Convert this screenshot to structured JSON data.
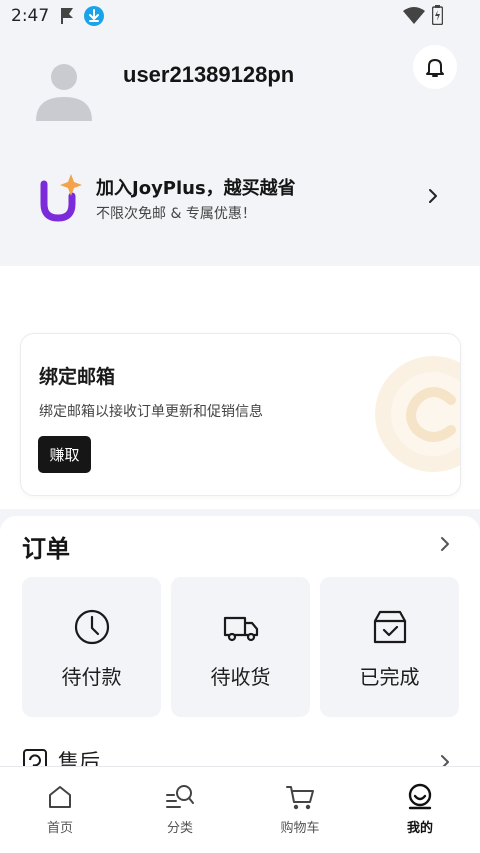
{
  "status_bar": {
    "time": "2:47"
  },
  "profile": {
    "username": "user21389128pn"
  },
  "joyplus": {
    "title": "加入JoyPlus，越买越省",
    "subtitle": "不限次免邮 & 专属优惠！"
  },
  "bind_email": {
    "title": "绑定邮箱",
    "description": "绑定邮箱以接收订单更新和促销信息",
    "button": "赚取"
  },
  "orders": {
    "title": "订单",
    "tiles": [
      {
        "label": "待付款",
        "icon": "clock-icon"
      },
      {
        "label": "待收货",
        "icon": "truck-icon"
      },
      {
        "label": "已完成",
        "icon": "box-check-icon"
      }
    ],
    "aftersale": "售后"
  },
  "nav": [
    {
      "label": "首页",
      "icon": "home-icon"
    },
    {
      "label": "分类",
      "icon": "category-search-icon"
    },
    {
      "label": "购物车",
      "icon": "cart-icon"
    },
    {
      "label": "我的",
      "icon": "me-icon",
      "active": true
    }
  ],
  "colors": {
    "accent_purple": "#7b2bd9",
    "accent_orange": "#f2a34b",
    "download_blue": "#1aa3e8"
  }
}
